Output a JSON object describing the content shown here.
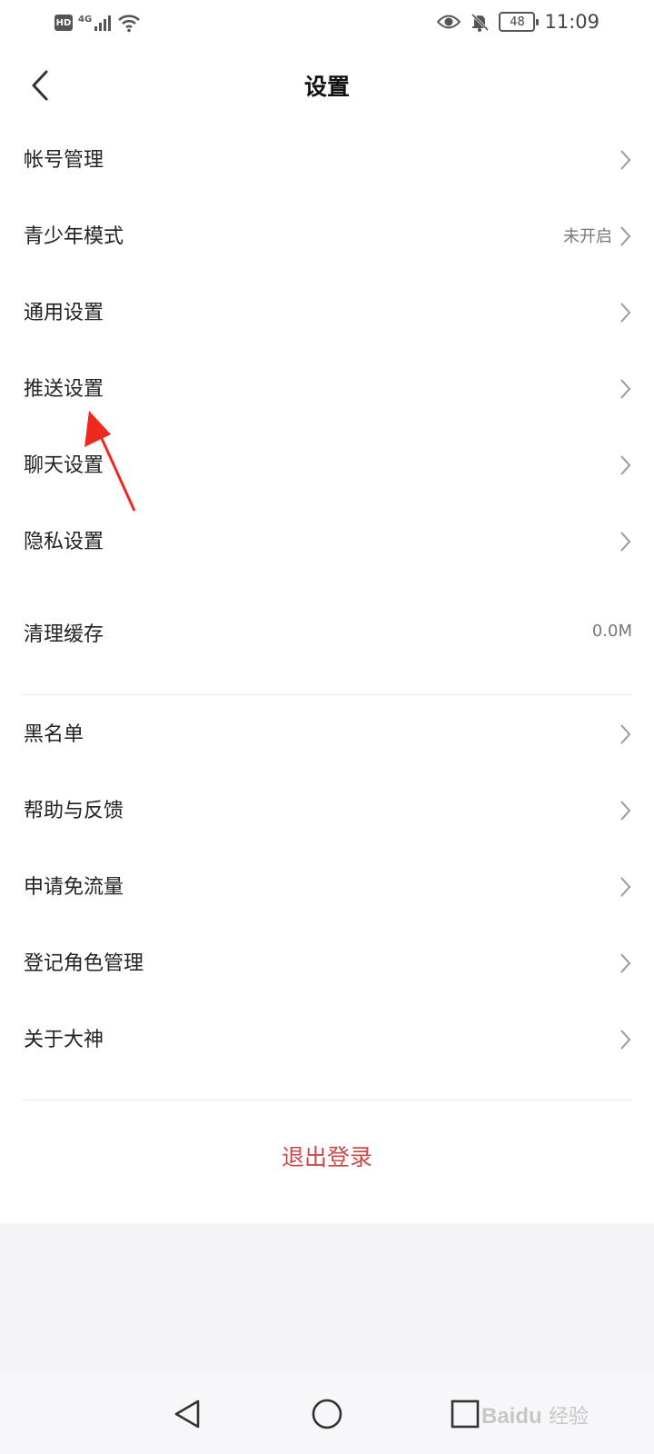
{
  "status_bar": {
    "hd": "HD",
    "network": "4G",
    "battery": "48",
    "time": "11:09"
  },
  "header": {
    "title": "设置"
  },
  "items": [
    {
      "label": "帐号管理",
      "value": ""
    },
    {
      "label": "青少年模式",
      "value": "未开启"
    },
    {
      "label": "通用设置",
      "value": ""
    },
    {
      "label": "推送设置",
      "value": ""
    },
    {
      "label": "聊天设置",
      "value": ""
    },
    {
      "label": "隐私设置",
      "value": ""
    },
    {
      "label": "清理缓存",
      "value": "0.0M"
    },
    {
      "label": "黑名单",
      "value": ""
    },
    {
      "label": "帮助与反馈",
      "value": ""
    },
    {
      "label": "申请免流量",
      "value": ""
    },
    {
      "label": "登记角色管理",
      "value": ""
    },
    {
      "label": "关于大神",
      "value": ""
    }
  ],
  "logout_label": "退出登录",
  "colors": {
    "accent": "#c94a4a",
    "annotation_arrow": "#ee2a1f",
    "background_grey": "#f4f4f6"
  },
  "watermark": "Baidu 经验"
}
